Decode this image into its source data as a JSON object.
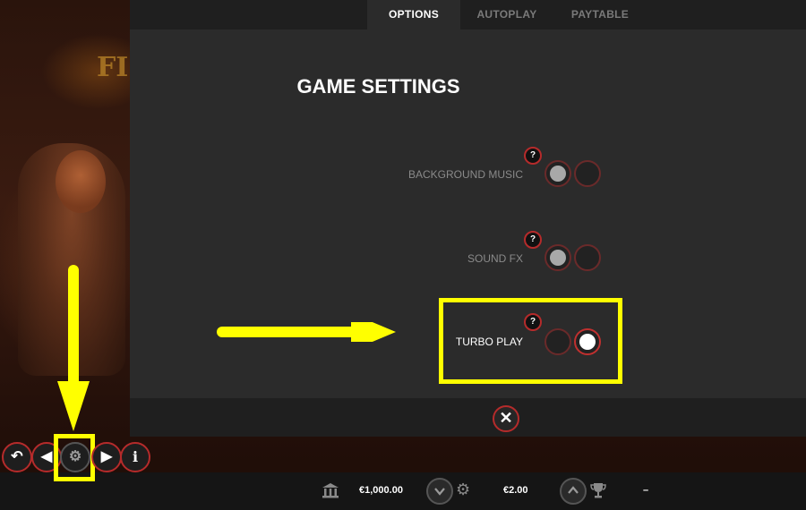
{
  "tabs": [
    {
      "label": "OPTIONS",
      "active": true
    },
    {
      "label": "AUTOPLAY",
      "active": false
    },
    {
      "label": "PAYTABLE",
      "active": false
    }
  ],
  "title": "GAME SETTINGS",
  "settings": [
    {
      "label": "BACKGROUND MUSIC",
      "help": "?",
      "value": "on"
    },
    {
      "label": "SOUND FX",
      "help": "?",
      "value": "on"
    },
    {
      "label": "TURBO PLAY",
      "help": "?",
      "value": "on"
    }
  ],
  "close_symbol": "✕",
  "scene_logo": "FI",
  "bottom_bar": {
    "balance": "€1,000.00",
    "bet": "€2.00",
    "win": "–"
  },
  "controls": {
    "back_icon": "↶",
    "prev_icon": "◀",
    "settings_icon": "⚙",
    "next_icon": "▶",
    "info_icon": "i"
  },
  "colors": {
    "highlight": "#ffff00",
    "accent_red": "#b52b2b",
    "panel": "#2b2b2b"
  }
}
